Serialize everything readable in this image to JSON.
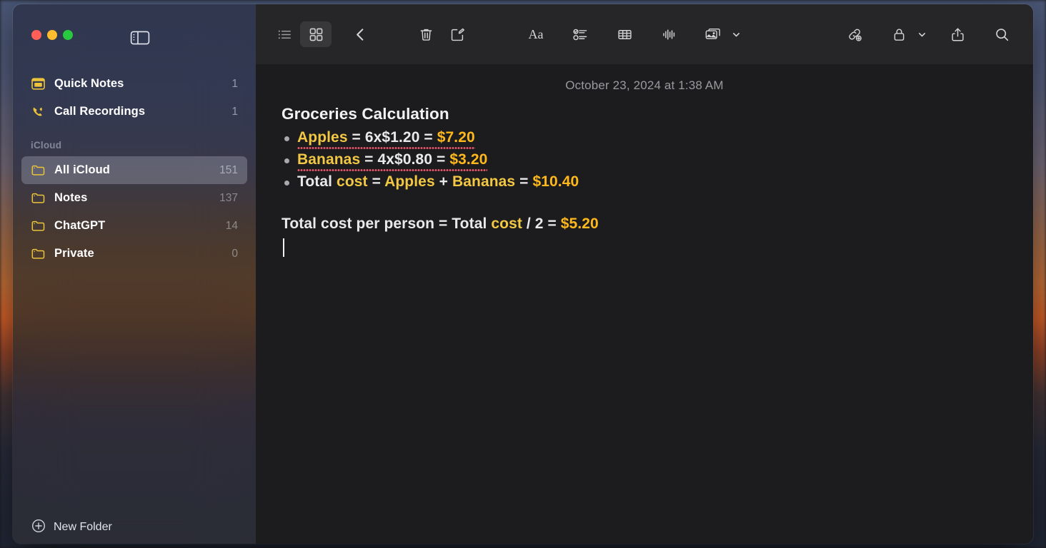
{
  "window": {
    "traffic_lights": [
      "close",
      "minimize",
      "zoom"
    ],
    "sidebar_toggle_icon": "sidebar-toggle-icon"
  },
  "sidebar": {
    "pinned": [
      {
        "label": "Quick Notes",
        "count": "1",
        "icon": "quick-notes-icon"
      },
      {
        "label": "Call Recordings",
        "count": "1",
        "icon": "call-recordings-icon"
      }
    ],
    "section_title": "iCloud",
    "folders": [
      {
        "label": "All iCloud",
        "count": "151",
        "icon": "folder-icon",
        "selected": true
      },
      {
        "label": "Notes",
        "count": "137",
        "icon": "folder-icon",
        "selected": false
      },
      {
        "label": "ChatGPT",
        "count": "14",
        "icon": "folder-icon",
        "selected": false
      },
      {
        "label": "Private",
        "count": "0",
        "icon": "folder-icon",
        "selected": false
      }
    ],
    "new_folder_label": "New Folder",
    "new_folder_icon": "plus-circle-icon"
  },
  "toolbar": {
    "buttons": [
      {
        "name": "list-view-icon",
        "active": false
      },
      {
        "name": "gallery-view-icon",
        "active": true
      },
      {
        "name": "back-chevron-icon",
        "active": false
      },
      {
        "name": "delete-note-icon",
        "active": false
      },
      {
        "name": "compose-note-icon",
        "active": false
      },
      {
        "name": "format-text-icon",
        "active": false
      },
      {
        "name": "checklist-icon",
        "active": false
      },
      {
        "name": "table-icon",
        "active": false
      },
      {
        "name": "audio-recording-icon",
        "active": false
      },
      {
        "name": "media-icon",
        "active": false
      },
      {
        "name": "link-add-icon",
        "active": false
      },
      {
        "name": "lock-icon",
        "active": false
      },
      {
        "name": "share-icon",
        "active": false
      },
      {
        "name": "search-icon",
        "active": false
      }
    ],
    "format_label": "Aa"
  },
  "note": {
    "date": "October 23, 2024 at 1:38 AM",
    "title": "Groceries Calculation",
    "bullets": [
      {
        "misspelled": true,
        "parts": [
          {
            "text": "Apples",
            "style": "gold"
          },
          {
            "text": " = ",
            "style": "white"
          },
          {
            "text": "6x$1.20",
            "style": "white"
          },
          {
            "text": "  = ",
            "style": "white"
          },
          {
            "text": "$7.20",
            "style": "amber"
          }
        ]
      },
      {
        "misspelled": true,
        "parts": [
          {
            "text": "Bananas",
            "style": "gold"
          },
          {
            "text": " = ",
            "style": "white"
          },
          {
            "text": "4x$0.80",
            "style": "white"
          },
          {
            "text": "  = ",
            "style": "white"
          },
          {
            "text": "$3.20",
            "style": "amber"
          }
        ]
      },
      {
        "misspelled": false,
        "parts": [
          {
            "text": "Total ",
            "style": "white"
          },
          {
            "text": "cost",
            "style": "gold"
          },
          {
            "text": " = ",
            "style": "white"
          },
          {
            "text": "Apples",
            "style": "gold"
          },
          {
            "text": " + ",
            "style": "white"
          },
          {
            "text": "Bananas",
            "style": "gold"
          },
          {
            "text": "  = ",
            "style": "white"
          },
          {
            "text": "$10.40",
            "style": "amber"
          }
        ]
      }
    ],
    "paragraph": [
      {
        "text": "Total cost per person = Total ",
        "style": "white"
      },
      {
        "text": "cost",
        "style": "gold"
      },
      {
        "text": " / 2  = ",
        "style": "white"
      },
      {
        "text": "$5.20",
        "style": "amber"
      }
    ],
    "caret_visible": true
  },
  "colors": {
    "gold": "#f2c744",
    "amber": "#ffb81c",
    "spellcheck_red": "#f0566b",
    "note_background": "#1c1c1e",
    "toolbar_background": "#262628"
  }
}
